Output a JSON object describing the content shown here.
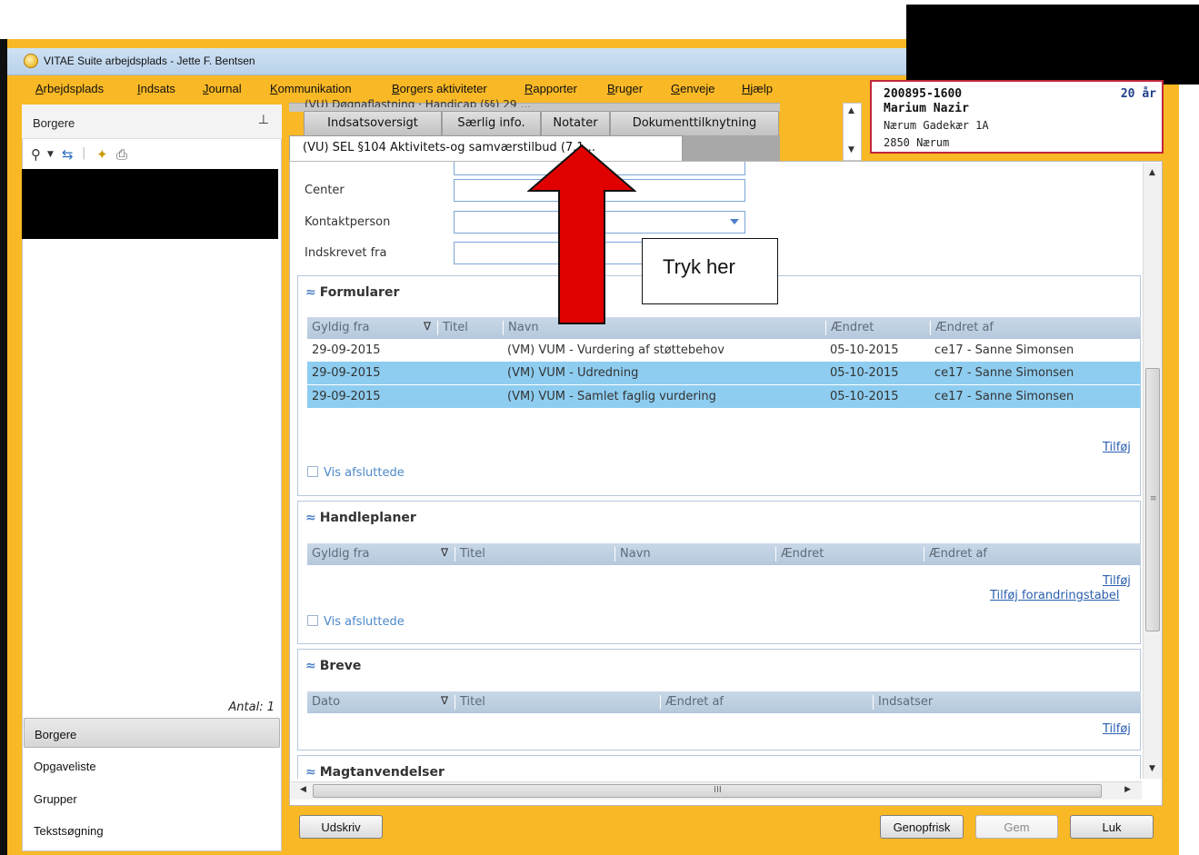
{
  "window": {
    "title": "VITAE Suite arbejdsplads - Jette F. Bentsen"
  },
  "menu": {
    "items": [
      {
        "ul": "A",
        "rest": "rbejdsplads"
      },
      {
        "ul": "I",
        "rest": "ndsats"
      },
      {
        "ul": "J",
        "rest": "ournal"
      },
      {
        "ul": "K",
        "rest": "ommunikation"
      },
      {
        "ul": "B",
        "rest": "orgers aktiviteter"
      },
      {
        "ul": "R",
        "rest": "apporter"
      },
      {
        "ul": "B",
        "rest": "ruger"
      },
      {
        "ul": "G",
        "rest": "enveje"
      },
      {
        "ul": "H",
        "rest": "jælp"
      }
    ]
  },
  "person": {
    "cpr": "200895-1600",
    "age": "20 år",
    "name": "Marium Nazir",
    "address1": "Nærum Gadekær 1A",
    "address2": "2850  Nærum"
  },
  "left": {
    "header": "Borgere",
    "count": "Antal: 1",
    "nav": [
      "Borgere",
      "Opgaveliste",
      "Grupper",
      "Tekstsøgning"
    ]
  },
  "tabs": {
    "back_row_text": "(VU) Døgnaflastning · Handicap (§§) 29 ...",
    "row1": [
      "Indsatsoversigt",
      "Særlig info.",
      "Notater",
      "Dokumenttilknytning"
    ],
    "active": "(VU) SEL §104 Aktivitets-og samværstilbud (7.1..."
  },
  "form": {
    "center_label": "Center",
    "contact_label": "Kontaktperson",
    "enrolled_label": "Indskrevet fra"
  },
  "formularer": {
    "title": "Formularer",
    "columns": [
      "Gyldig fra",
      "Titel",
      "Navn",
      "Ændret",
      "Ændret af"
    ],
    "rows": [
      {
        "gyldig_fra": "29-09-2015",
        "titel": "",
        "navn": "(VM) VUM - Vurdering af støttebehov",
        "aendret": "05-10-2015",
        "aendret_af": "ce17 - Sanne Simonsen",
        "selected": false
      },
      {
        "gyldig_fra": "29-09-2015",
        "titel": "",
        "navn": "(VM) VUM - Udredning",
        "aendret": "05-10-2015",
        "aendret_af": "ce17 - Sanne Simonsen",
        "selected": true
      },
      {
        "gyldig_fra": "29-09-2015",
        "titel": "",
        "navn": "(VM) VUM - Samlet faglig vurdering",
        "aendret": "05-10-2015",
        "aendret_af": "ce17 - Sanne Simonsen",
        "selected": true
      }
    ],
    "add_link": "Tilføj",
    "show_closed": "Vis afsluttede"
  },
  "handleplaner": {
    "title": "Handleplaner",
    "columns": [
      "Gyldig fra",
      "Titel",
      "Navn",
      "Ændret",
      "Ændret af"
    ],
    "add_link": "Tilføj",
    "add_change_table_link": "Tilføj forandringstabel",
    "show_closed": "Vis afsluttede"
  },
  "breve": {
    "title": "Breve",
    "columns": [
      "Dato",
      "Titel",
      "Ændret af",
      "Indsatser"
    ],
    "add_link": "Tilføj"
  },
  "magtanvendelser": {
    "title": "Magtanvendelser"
  },
  "buttons": {
    "print": "Udskriv",
    "refresh": "Genopfrisk",
    "save": "Gem",
    "close": "Luk"
  },
  "annotation": {
    "callout": "Tryk her"
  },
  "colors": {
    "frame": "#f9b825",
    "selected_row": "#8ecdf0",
    "arrow": "#e00000",
    "card_border": "#c0273a"
  }
}
